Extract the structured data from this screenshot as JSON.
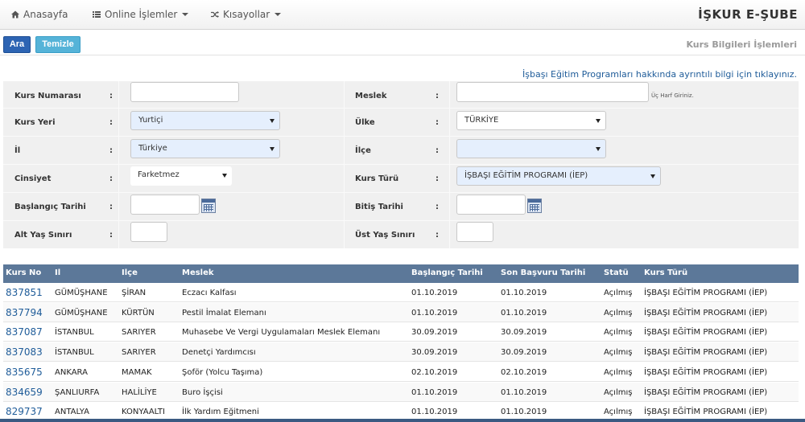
{
  "nav": {
    "home": "Anasayfa",
    "online": "Online İşlemler",
    "shortcuts": "Kısayollar",
    "brand": "İŞKUR E-ŞUBE"
  },
  "toolbar": {
    "search_label": "Ara",
    "clear_label": "Temizle",
    "section_title": "Kurs Bilgileri İşlemleri"
  },
  "info_link": "İşbaşı Eğitim Programları hakkında ayrıntılı bilgi için tıklayınız.",
  "form": {
    "course_no_label": "Kurs Numarası",
    "course_no_value": "",
    "profession_label": "Meslek",
    "profession_value": "",
    "profession_hint": "Üç Harf Giriniz.",
    "location_label": "Kurs Yeri",
    "location_value": "Yurtiçi",
    "country_label": "Ülke",
    "country_value": "TÜRKİYE",
    "province_label": "İl",
    "province_value": "Türkiye",
    "district_label": "İlçe",
    "district_value": "",
    "gender_label": "Cinsiyet",
    "gender_value": "Farketmez",
    "type_label": "Kurs Türü",
    "type_value": "İŞBAŞI EĞİTİM PROGRAMI (İEP)",
    "start_label": "Başlangıç Tarihi",
    "start_value": "",
    "end_label": "Bitiş Tarihi",
    "end_value": "",
    "min_age_label": "Alt Yaş Sınırı",
    "min_age_value": "",
    "max_age_label": "Üst Yaş Sınırı",
    "max_age_value": "",
    "colon": ":"
  },
  "table": {
    "headers": [
      "Kurs No",
      "Il",
      "Ilçe",
      "Meslek",
      "Başlangıç Tarihi",
      "Son Başvuru Tarihi",
      "Statü",
      "Kurs Türü"
    ],
    "rows": [
      [
        "837851",
        "GÜMÜŞHANE",
        "ŞİRAN",
        "Eczacı Kalfası",
        "01.10.2019",
        "01.10.2019",
        "Açılmış",
        "İŞBAŞI EĞİTİM PROGRAMI (İEP)"
      ],
      [
        "837794",
        "GÜMÜŞHANE",
        "KÜRTÜN",
        "Pestil İmalat Elemanı",
        "01.10.2019",
        "01.10.2019",
        "Açılmış",
        "İŞBAŞI EĞİTİM PROGRAMI (İEP)"
      ],
      [
        "837087",
        "İSTANBUL",
        "SARIYER",
        "Muhasebe Ve Vergi Uygulamaları Meslek Elemanı",
        "30.09.2019",
        "30.09.2019",
        "Açılmış",
        "İŞBAŞI EĞİTİM PROGRAMI (İEP)"
      ],
      [
        "837083",
        "İSTANBUL",
        "SARIYER",
        "Denetçi Yardımcısı",
        "30.09.2019",
        "30.09.2019",
        "Açılmış",
        "İŞBAŞI EĞİTİM PROGRAMI (İEP)"
      ],
      [
        "835675",
        "ANKARA",
        "MAMAK",
        "Şoför (Yolcu Taşıma)",
        "02.10.2019",
        "02.10.2019",
        "Açılmış",
        "İŞBAŞI EĞİTİM PROGRAMI (İEP)"
      ],
      [
        "834659",
        "ŞANLIURFA",
        "HALİLİYE",
        "Buro İşçisi",
        "01.10.2019",
        "01.10.2019",
        "Açılmış",
        "İŞBAŞI EĞİTİM PROGRAMI (İEP)"
      ],
      [
        "829737",
        "ANTALYA",
        "KONYAALTI",
        "İlk Yardım Eğitmeni",
        "01.10.2019",
        "01.10.2019",
        "Açılmış",
        "İŞBAŞI EĞİTİM PROGRAMI (İEP)"
      ]
    ]
  },
  "colors": {
    "primary_button": "#2d64b3",
    "info_button": "#55b3d8",
    "table_header": "#5c7899",
    "link": "#1f5c99"
  },
  "icons": [
    "home-icon",
    "list-icon",
    "shuffle-icon",
    "calendar-icon",
    "caret-down-icon"
  ]
}
